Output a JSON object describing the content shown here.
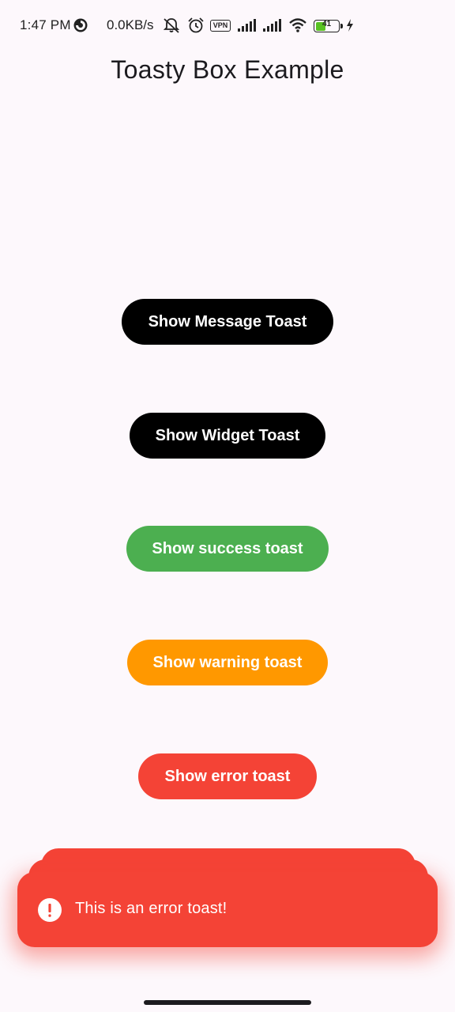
{
  "status_bar": {
    "time": "1:47 PM",
    "net_speed": "0.0KB/s",
    "vpn_label": "VPN",
    "battery_level": "41",
    "icons": [
      "data-saver-icon",
      "bell-off-icon",
      "alarm-icon",
      "vpn-icon",
      "signal-icon",
      "signal-icon",
      "wifi-icon",
      "battery-icon",
      "charging-bolt-icon"
    ]
  },
  "app_bar": {
    "title": "Toasty Box Example"
  },
  "buttons": {
    "message": "Show Message Toast",
    "widget": "Show Widget Toast",
    "success": "Show success toast",
    "warning": "Show warning toast",
    "error": "Show error toast"
  },
  "toast": {
    "icon": "error-icon",
    "message": "This is an error toast!"
  },
  "colors": {
    "background": "#fdf8fc",
    "black_button": "#000000",
    "success": "#4caf50",
    "warning": "#ff9800",
    "error": "#f44336",
    "battery_fill": "#58c322"
  }
}
